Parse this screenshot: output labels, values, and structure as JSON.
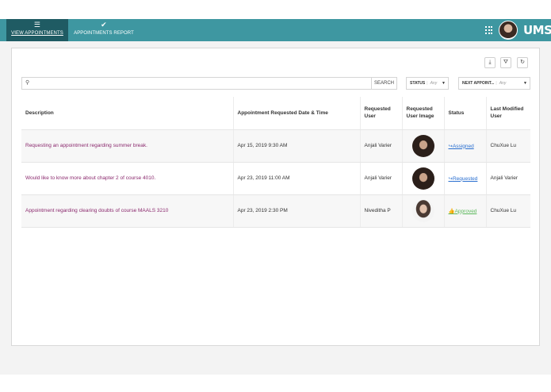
{
  "nav": {
    "tabs": [
      {
        "label": "VIEW APPOINTMENTS",
        "icon": "list-icon"
      },
      {
        "label": "APPOINTMENTS REPORT",
        "icon": "check-icon"
      }
    ],
    "logo": "UMS"
  },
  "toolbar": {
    "download_icon": "⤓",
    "filter_icon": "⛛",
    "refresh_icon": "↻"
  },
  "search": {
    "placeholder": "",
    "button_label": "SEARCH",
    "icon": "⚲"
  },
  "filters": [
    {
      "label": "STATUS",
      "value": "Any"
    },
    {
      "label": "NEXT APPOINT...",
      "value": "Any"
    }
  ],
  "table": {
    "headers": [
      "Description",
      "Appointment Requested Date & Time",
      "Requested User",
      "Requested User Image",
      "Status",
      "Last Modified User"
    ],
    "rows": [
      {
        "description": "Requesting an appointment regarding summer break.",
        "datetime": "Apr 15, 2019 9:30 AM",
        "user": "Anjali Varier",
        "status": "Assigned",
        "status_icon": "↪",
        "modified_by": "ChuXue Lu"
      },
      {
        "description": "Would like to know more about chapter 2 of course 4010.",
        "datetime": "Apr 23, 2019 11:00 AM",
        "user": "Anjali Varier",
        "status": "Requested",
        "status_icon": "↪",
        "modified_by": "Anjali Varier"
      },
      {
        "description": "Appointment regarding clearing doubts of course MAALS 3210",
        "datetime": "Apr 23, 2019 2:30 PM",
        "user": "Niveditha P",
        "status": "Approved",
        "status_icon": "👍",
        "modified_by": "ChuXue Lu"
      }
    ]
  },
  "colors": {
    "topbar": "#3e97a1",
    "active_tab": "#1f5b63",
    "description_link": "#8b2a6e",
    "status_blue": "#2a6fd0",
    "status_green": "#5cb85c"
  }
}
